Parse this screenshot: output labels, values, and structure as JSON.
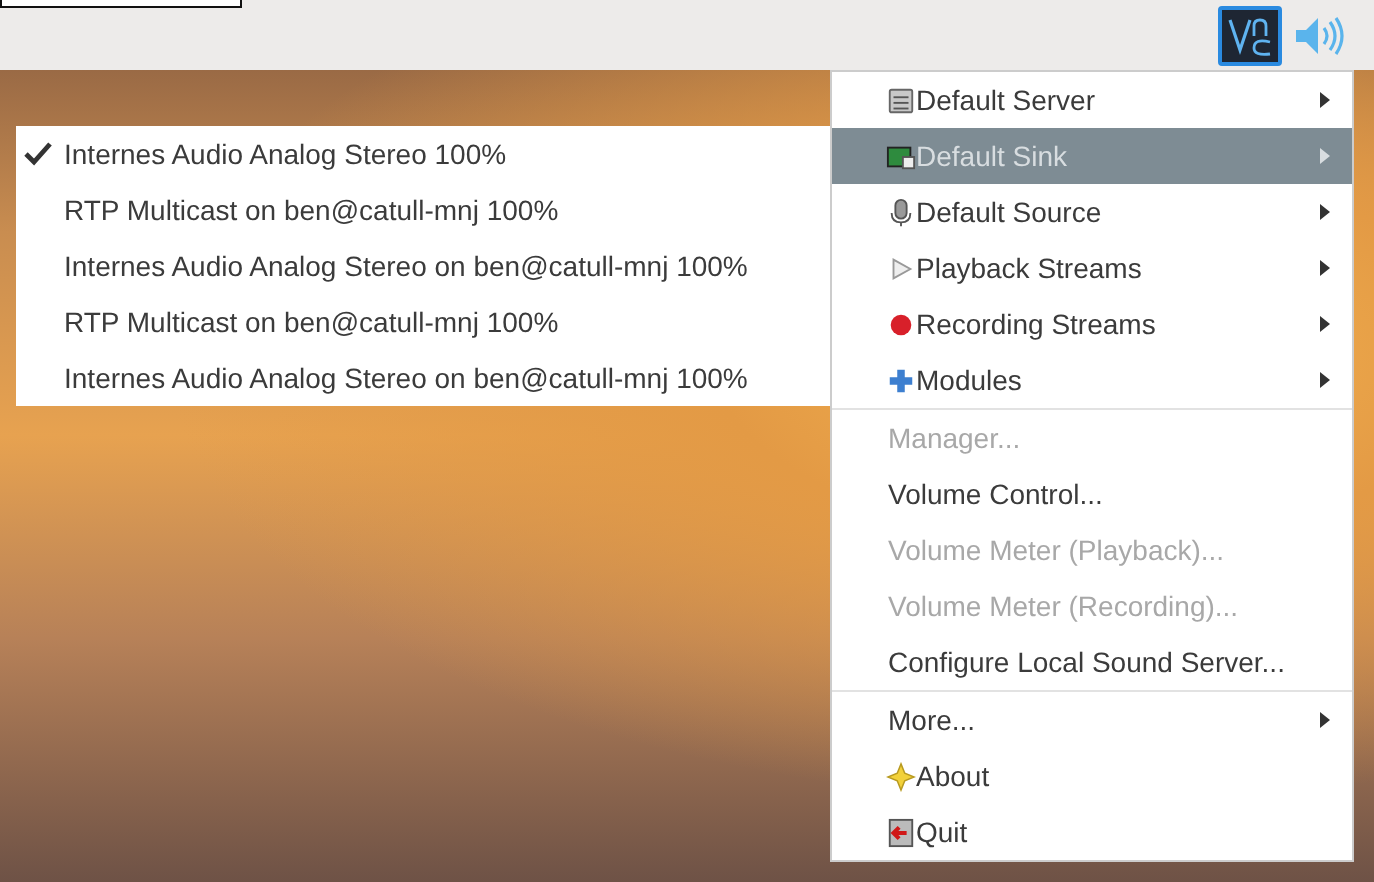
{
  "menu": {
    "sections": [
      [
        {
          "label": "Default Server",
          "kind": "submenu",
          "disabled": false,
          "selected": false
        },
        {
          "label": "Default Sink",
          "kind": "submenu",
          "disabled": false,
          "selected": true
        },
        {
          "label": "Default Source",
          "kind": "submenu",
          "disabled": false,
          "selected": false
        },
        {
          "label": "Playback Streams",
          "kind": "submenu",
          "disabled": false,
          "selected": false
        },
        {
          "label": "Recording Streams",
          "kind": "submenu",
          "disabled": false,
          "selected": false
        },
        {
          "label": "Modules",
          "kind": "submenu",
          "disabled": false,
          "selected": false
        }
      ],
      [
        {
          "label": "Manager...",
          "kind": "action",
          "disabled": true,
          "selected": false
        },
        {
          "label": "Volume Control...",
          "kind": "action",
          "disabled": false,
          "selected": false
        },
        {
          "label": "Volume Meter (Playback)...",
          "kind": "action",
          "disabled": true,
          "selected": false
        },
        {
          "label": "Volume Meter (Recording)...",
          "kind": "action",
          "disabled": true,
          "selected": false
        },
        {
          "label": "Configure Local Sound Server...",
          "kind": "action",
          "disabled": false,
          "selected": false
        }
      ],
      [
        {
          "label": "More...",
          "kind": "submenu",
          "disabled": false,
          "selected": false
        },
        {
          "label": "About",
          "kind": "action",
          "disabled": false,
          "selected": false
        },
        {
          "label": "Quit",
          "kind": "action",
          "disabled": false,
          "selected": false
        }
      ]
    ]
  },
  "submenu": {
    "items": [
      {
        "label": "Internes Audio Analog Stereo 100%",
        "checked": true
      },
      {
        "label": "RTP Multicast on ben@catull-mnj 100%",
        "checked": false
      },
      {
        "label": "Internes Audio Analog Stereo on ben@catull-mnj 100%",
        "checked": false
      },
      {
        "label": "RTP Multicast on ben@catull-mnj 100%",
        "checked": false
      },
      {
        "label": "Internes Audio Analog Stereo on ben@catull-mnj 100%",
        "checked": false
      }
    ]
  }
}
